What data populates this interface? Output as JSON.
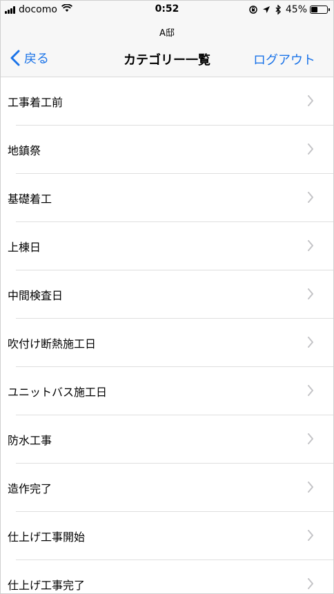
{
  "status_bar": {
    "carrier": "docomo",
    "time": "0:52",
    "battery_percent": "45%",
    "battery_level": 0.45,
    "icons": [
      "signal-icon",
      "wifi-icon",
      "rotation-lock-icon",
      "location-icon",
      "bluetooth-icon",
      "battery-icon"
    ]
  },
  "nav": {
    "prompt": "A邸",
    "back_label": "戻る",
    "title": "カテゴリー一覧",
    "right_label": "ログアウト",
    "accent_color": "#1a73e8"
  },
  "categories": [
    {
      "label": "工事着工前"
    },
    {
      "label": "地鎮祭"
    },
    {
      "label": "基礎着工"
    },
    {
      "label": "上棟日"
    },
    {
      "label": "中間検査日"
    },
    {
      "label": "吹付け断熱施工日"
    },
    {
      "label": "ユニットバス施工日"
    },
    {
      "label": "防水工事"
    },
    {
      "label": "造作完了"
    },
    {
      "label": "仕上げ工事開始"
    },
    {
      "label": "仕上げ工事完了"
    }
  ]
}
